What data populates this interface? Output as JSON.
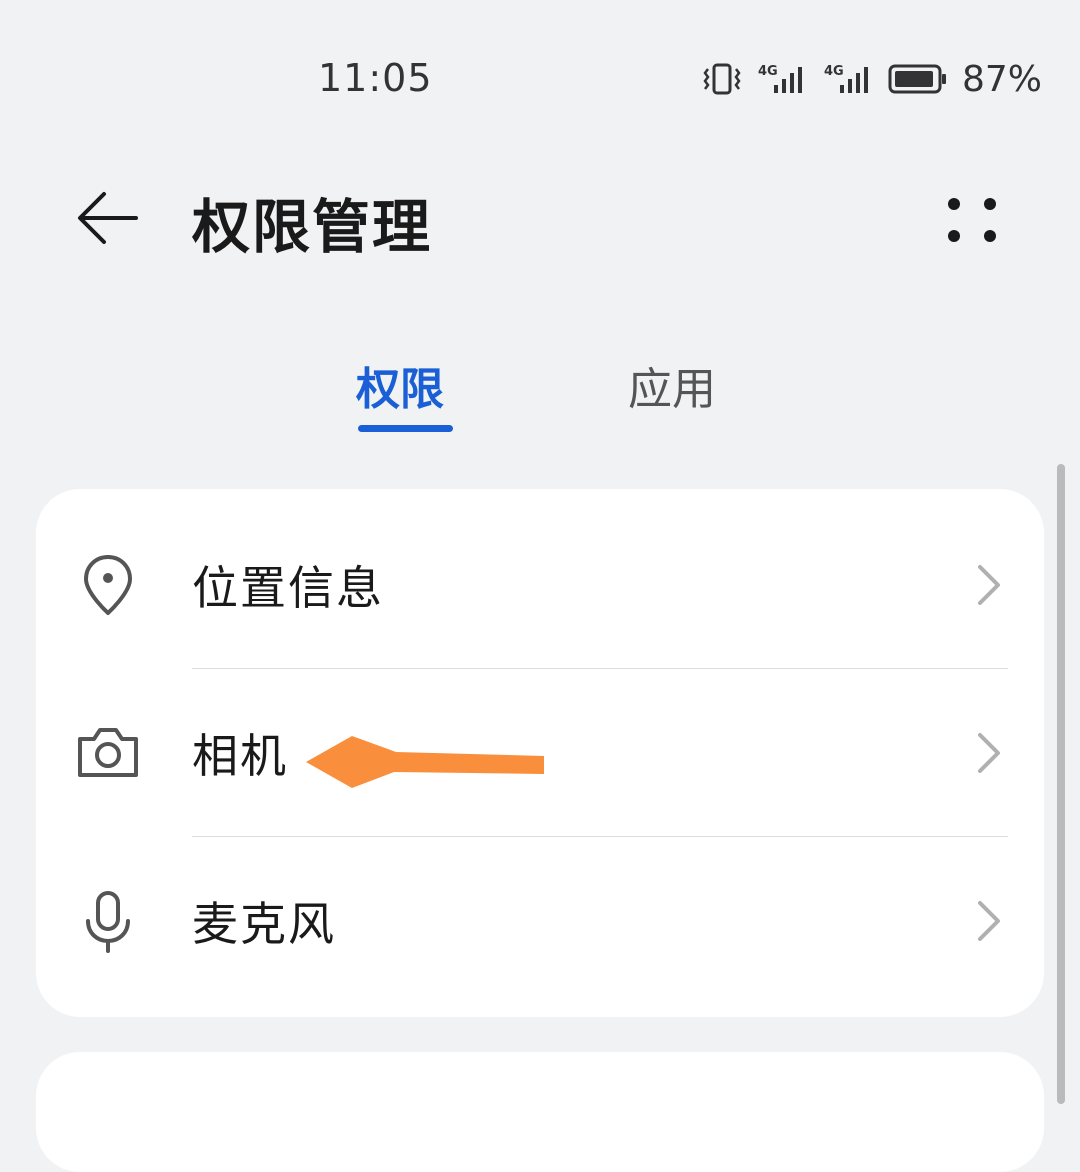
{
  "status_bar": {
    "time": "11:05",
    "battery_percent": "87%",
    "signal_1_label": "4G",
    "signal_2_label": "4G",
    "icons": [
      "vibrate-icon",
      "signal-4g-icon",
      "signal-4g-icon",
      "battery-icon"
    ]
  },
  "header": {
    "title": "权限管理",
    "back_icon": "arrow-left-icon",
    "more_icon": "more-dots-icon"
  },
  "tabs": [
    {
      "label": "权限",
      "active": true
    },
    {
      "label": "应用",
      "active": false
    }
  ],
  "permissions": [
    {
      "label": "位置信息",
      "icon": "location-pin-icon"
    },
    {
      "label": "相机",
      "icon": "camera-icon"
    },
    {
      "label": "麦克风",
      "icon": "microphone-icon"
    }
  ],
  "colors": {
    "accent": "#1a5fd6",
    "background": "#f1f2f4",
    "card": "#ffffff",
    "annotation_arrow": "#f98f3c"
  }
}
